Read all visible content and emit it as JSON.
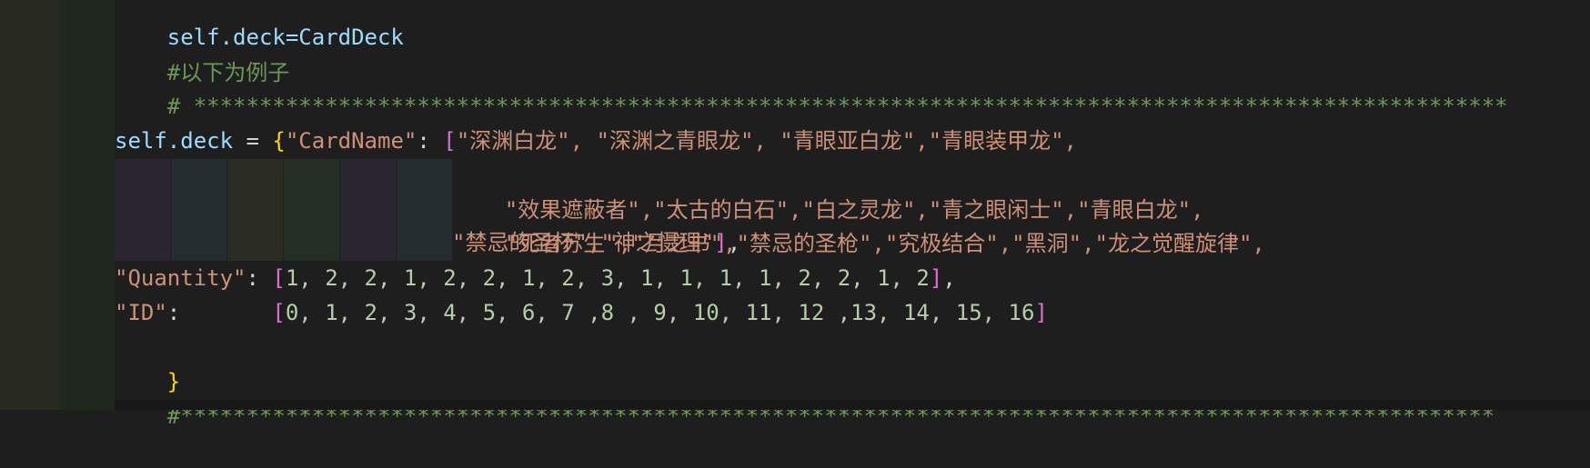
{
  "editor": {
    "lines": {
      "l0": "self.deck=CardDeck",
      "l1": "#以下为例子",
      "l2": "# ****************************************************************************************************",
      "l4_var": "self.deck",
      "l4_eq": " = ",
      "l4_brace": "{",
      "l4_key": "\"CardName\"",
      "l4_colon": ": ",
      "l4_bracket": "[",
      "l4_vals": "\"深渊白龙\", \"深渊之青眼龙\", \"青眼亚白龙\",\"青眼装甲龙\",",
      "l5_vals": "\"效果遮蔽者\",\"太古的白石\",\"白之灵龙\",\"青之眼闲士\",\"青眼白龙\",",
      "l6_vals": "\"死者苏生\",\"月之书\",\"禁忌的圣枪\",\"究极结合\",\"黑洞\",\"龙之觉醒旋律\",",
      "l7_vals": "\"禁忌的圣杯\",\"神之慑理\"",
      "l7_close": "]",
      "l7_comma": ",",
      "l8_key": "\"Quantity\"",
      "l8_colon": ": ",
      "l8_open": "[",
      "l8_vals": "1, 2, 2, 1, 2, 2, 1, 2, 3, 1, 1, 1, 1, 2, 2, 1, 2",
      "l8_close": "]",
      "l8_comma": ",",
      "l9_key": "\"ID\"",
      "l9_colon": ":       ",
      "l9_open": "[",
      "l9_vals": "0, 1, 2, 3, 4, 5, 6, 7 ,8 , 9, 10, 11, 12 ,13, 14, 15, 16",
      "l9_close": "]",
      "l10_brace": "}",
      "l11": "#****************************************************************************************************"
    },
    "colors": {
      "background": "#1e1e1e",
      "variable": "#9cdcfe",
      "string": "#ce9178",
      "number": "#b5cea8",
      "comment": "#6a9955",
      "bracket_level1": "#ffd700",
      "bracket_level2": "#da70d6",
      "bracket_level3": "#179fff"
    }
  }
}
